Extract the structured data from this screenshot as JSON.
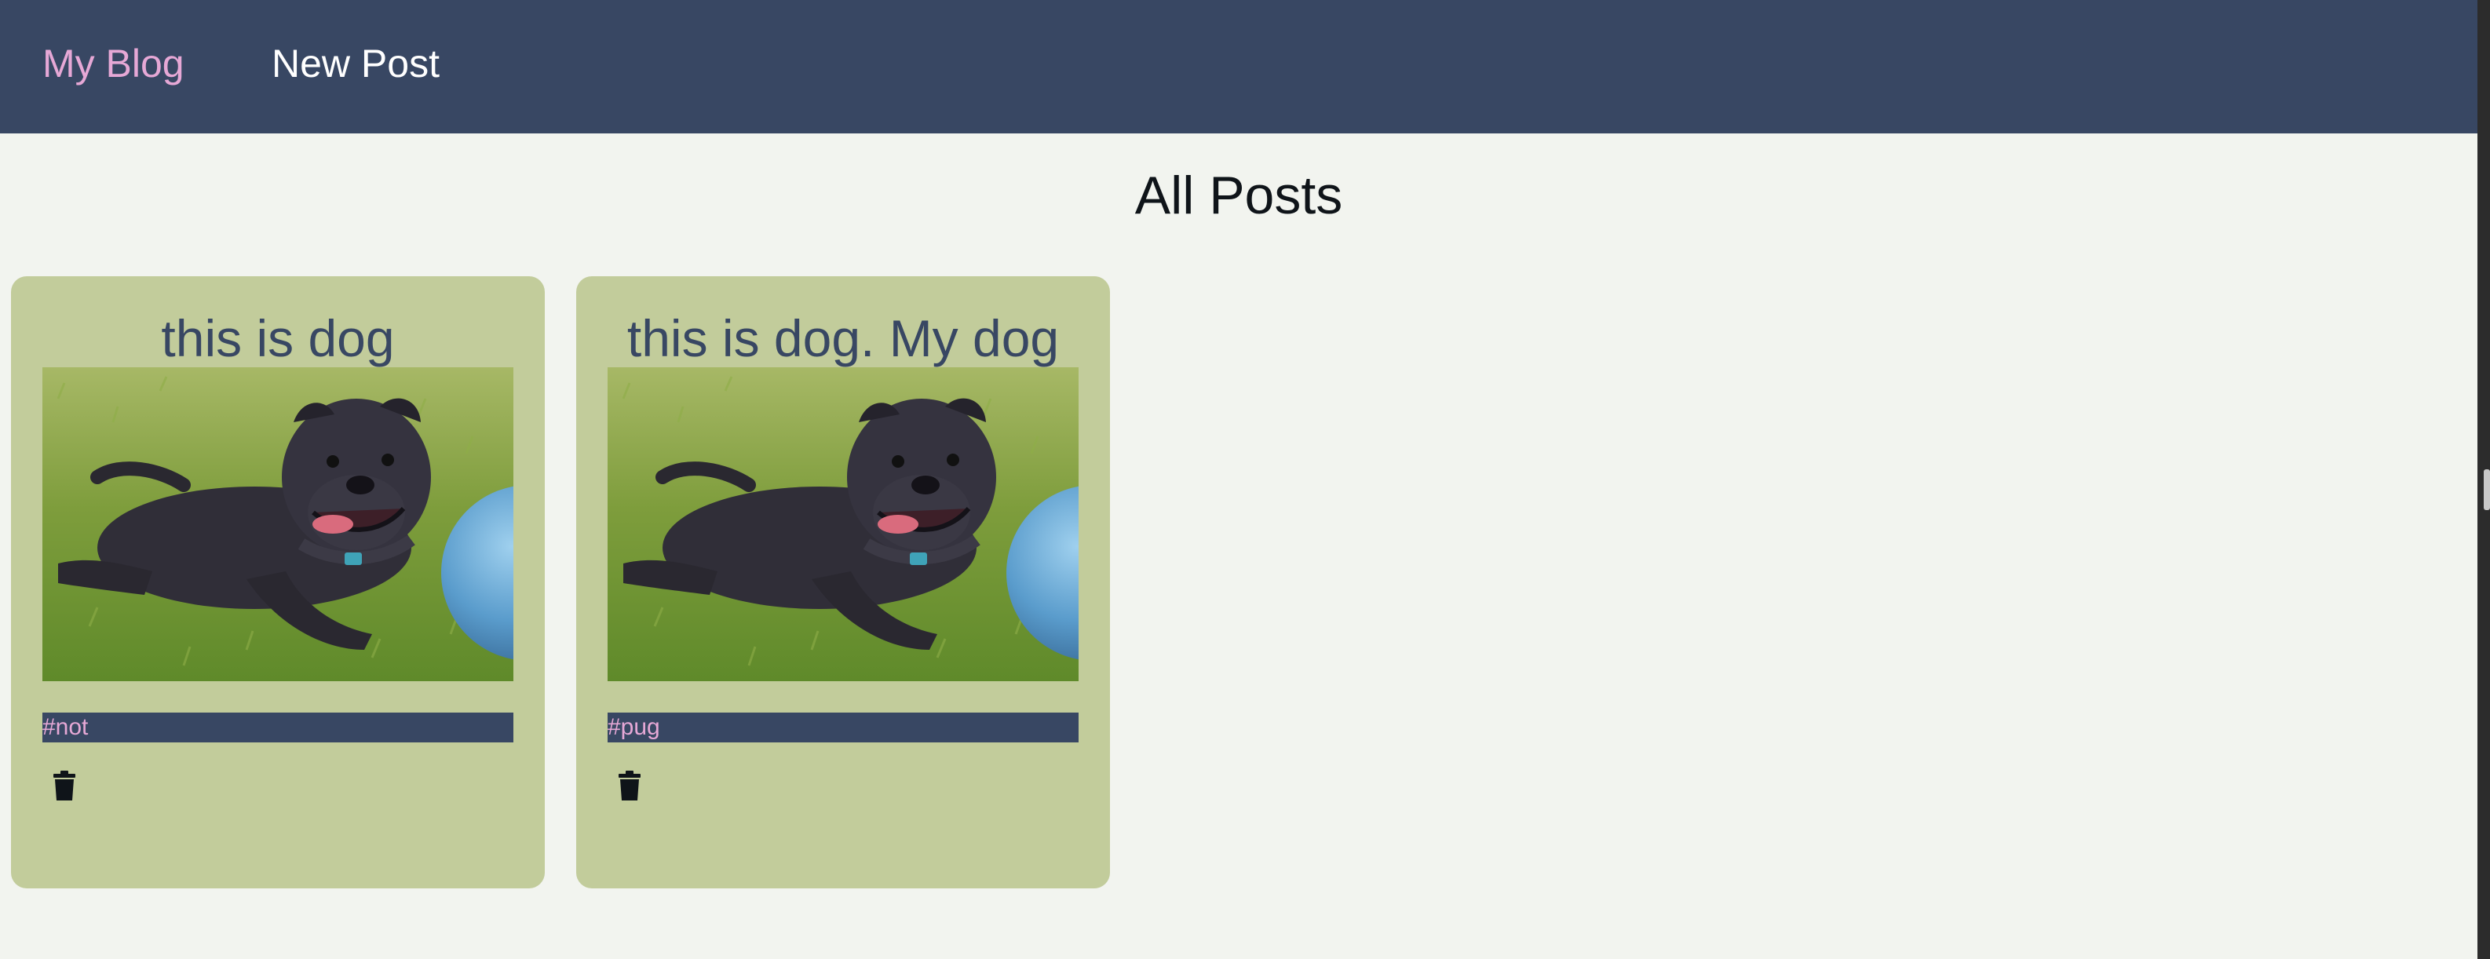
{
  "nav": {
    "brand": "My Blog",
    "new_post": "New Post",
    "brand_color": "#e6a8d6",
    "background": "#384763"
  },
  "page": {
    "title": "All Posts"
  },
  "posts": [
    {
      "title": "this is dog",
      "tag": "#not",
      "image": "dog-photo",
      "delete_icon": "trash-icon"
    },
    {
      "title": "this is dog. My dog",
      "tag": "#pug",
      "image": "dog-photo",
      "delete_icon": "trash-icon"
    }
  ],
  "colors": {
    "page_background": "#f2f4ef",
    "card_background": "#c2cc9b",
    "card_title": "#384763",
    "tag_background": "#384763",
    "tag_text": "#e6a8d6"
  }
}
